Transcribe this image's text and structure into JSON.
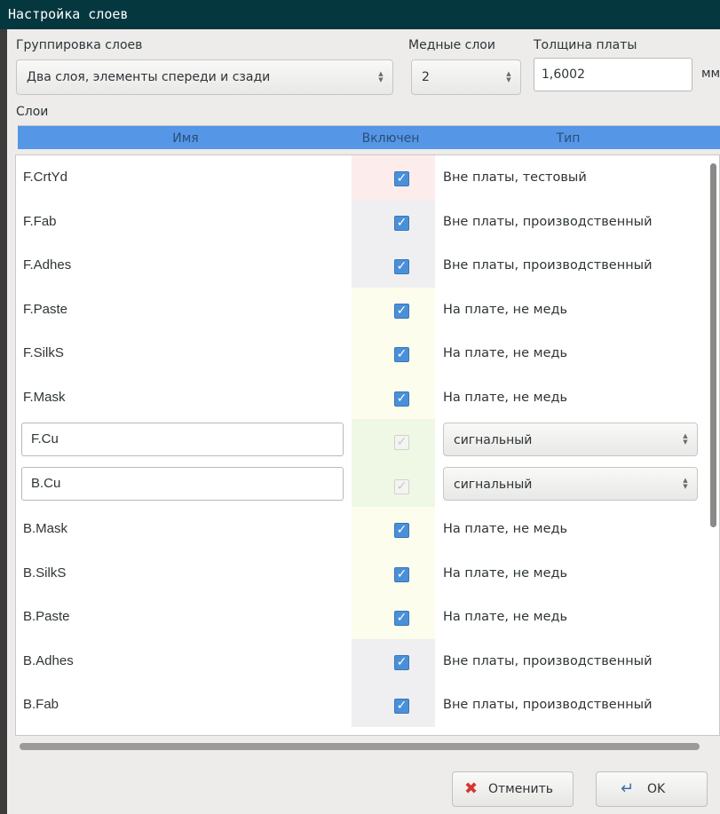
{
  "window": {
    "title": "Настройка слоев"
  },
  "layer_grouping": {
    "label": "Группировка слоев",
    "value": "Два слоя, элементы спереди и сзади"
  },
  "copper_layers": {
    "label": "Медные слои",
    "value": "2"
  },
  "board_thickness": {
    "label": "Толщина платы",
    "value": "1,6002",
    "unit": "мм"
  },
  "layers_section": {
    "label": "Слои"
  },
  "columns": {
    "name": "Имя",
    "enabled": "Включен",
    "type": "Тип"
  },
  "rows": [
    {
      "name": "F.CrtYd",
      "type": "Вне платы, тестовый",
      "enabled": true,
      "editable": false,
      "cell_color": "#fcecec"
    },
    {
      "name": "F.Fab",
      "type": "Вне платы, производственный",
      "enabled": true,
      "editable": false,
      "cell_color": "#efeff1"
    },
    {
      "name": "F.Adhes",
      "type": "Вне платы, производственный",
      "enabled": true,
      "editable": false,
      "cell_color": "#efeff1"
    },
    {
      "name": "F.Paste",
      "type": "На плате, не медь",
      "enabled": true,
      "editable": false,
      "cell_color": "#fdfdee"
    },
    {
      "name": "F.SilkS",
      "type": "На плате, не медь",
      "enabled": true,
      "editable": false,
      "cell_color": "#fdfdee"
    },
    {
      "name": "F.Mask",
      "type": "На плате, не медь",
      "enabled": true,
      "editable": false,
      "cell_color": "#fdfdee"
    },
    {
      "name": "F.Cu",
      "type": "сигнальный",
      "enabled": true,
      "editable": true,
      "cell_color": "#eef8e4"
    },
    {
      "name": "B.Cu",
      "type": "сигнальный",
      "enabled": true,
      "editable": true,
      "cell_color": "#eef8e4"
    },
    {
      "name": "B.Mask",
      "type": "На плате, не медь",
      "enabled": true,
      "editable": false,
      "cell_color": "#fdfdee"
    },
    {
      "name": "B.SilkS",
      "type": "На плате, не медь",
      "enabled": true,
      "editable": false,
      "cell_color": "#fdfdee"
    },
    {
      "name": "B.Paste",
      "type": "На плате, не медь",
      "enabled": true,
      "editable": false,
      "cell_color": "#fdfdee"
    },
    {
      "name": "B.Adhes",
      "type": "Вне платы, производственный",
      "enabled": true,
      "editable": false,
      "cell_color": "#efeff1"
    },
    {
      "name": "B.Fab",
      "type": "Вне платы, производственный",
      "enabled": true,
      "editable": false,
      "cell_color": "#efeff1"
    }
  ],
  "buttons": {
    "cancel": {
      "label": "Отменить",
      "icon": "cancel-x-icon"
    },
    "ok": {
      "label": "OK",
      "icon": "enter-arrow-icon"
    }
  },
  "colors": {
    "titlebar": "#05373f",
    "header": "#5596e6",
    "checkbox": "#4a90d9"
  }
}
